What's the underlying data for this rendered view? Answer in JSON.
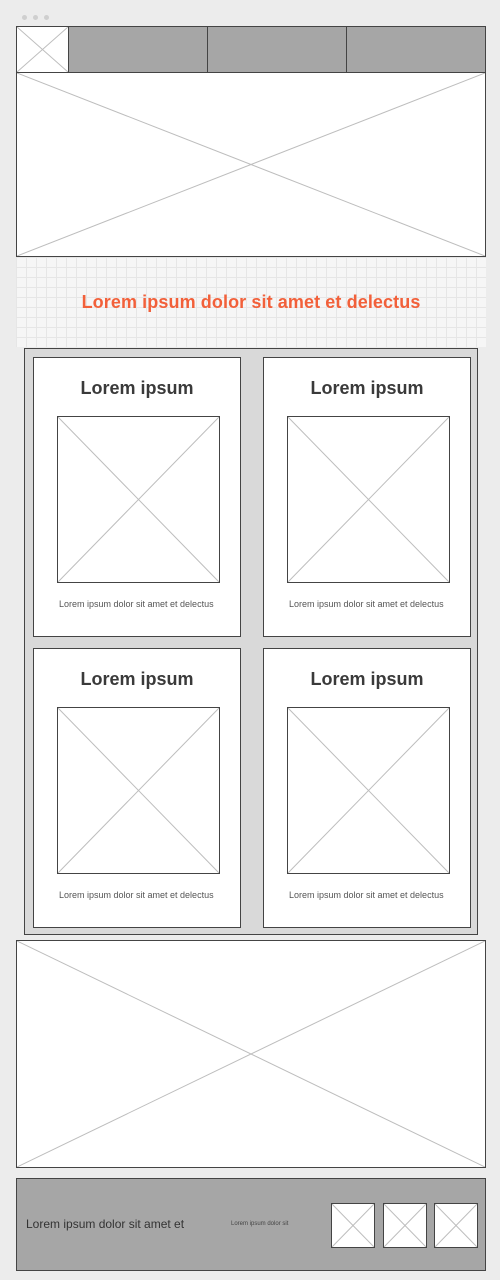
{
  "headline": "Lorem ipsum dolor sit amet et delectus",
  "cards": [
    {
      "title": "Lorem ipsum",
      "text": "Lorem ipsum dolor sit amet et delectus"
    },
    {
      "title": "Lorem ipsum",
      "text": "Lorem ipsum dolor sit amet et delectus"
    },
    {
      "title": "Lorem ipsum",
      "text": "Lorem ipsum dolor sit amet et delectus"
    },
    {
      "title": "Lorem ipsum",
      "text": "Lorem ipsum dolor sit amet et delectus"
    }
  ],
  "footer": {
    "text": "Lorem ipsum dolor sit amet et",
    "small_text": "Lorem ipsum dolor sit"
  },
  "colors": {
    "headline": "#f2603a",
    "nav_tab": "#a6a6a6",
    "footer_bg": "#a6a6a6",
    "grid_bg": "#d9d9d9"
  }
}
